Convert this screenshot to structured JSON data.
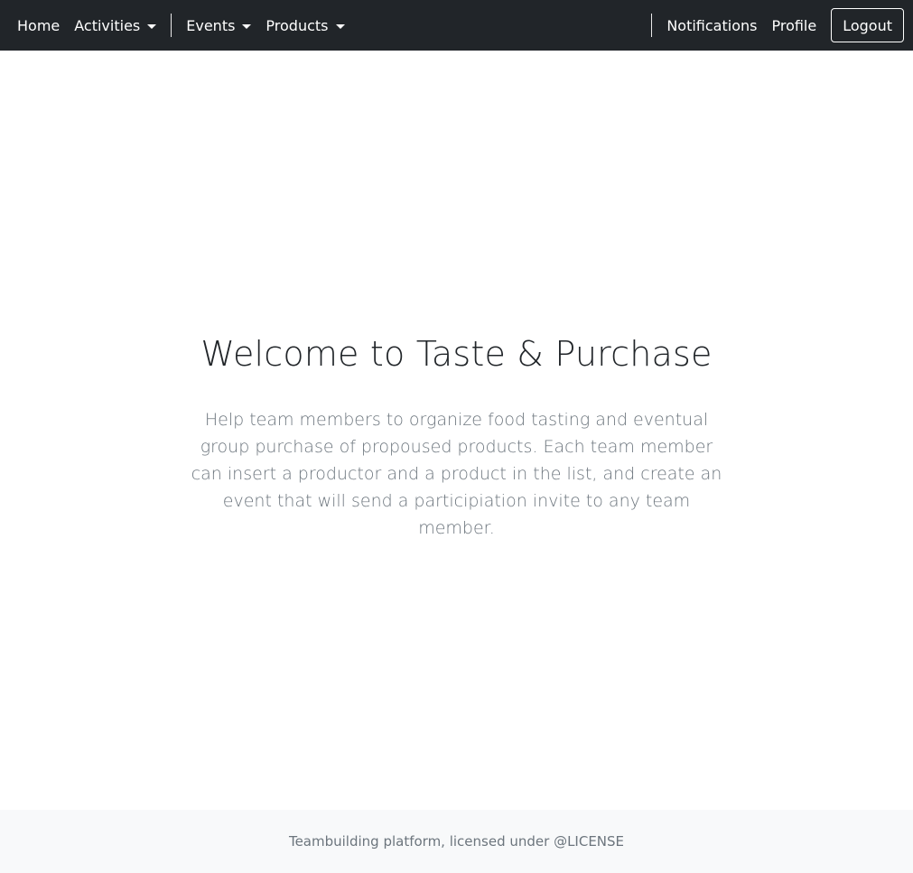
{
  "navbar": {
    "left": {
      "home_label": "Home",
      "activities_label": "Activities",
      "events_label": "Events",
      "products_label": "Products"
    },
    "right": {
      "notifications_label": "Notifications",
      "profile_label": "Profile",
      "logout_label": "Logout"
    },
    "icons": {
      "dropdown_caret": "chevron-down-icon"
    },
    "colors": {
      "background": "#212529",
      "text": "#ffffff"
    }
  },
  "hero": {
    "title": "Welcome to Taste & Purchase",
    "description": "Help team members to organize food tasting and eventual group purchase of propoused products. Each team member can insert a productor and a product in the list, and create an event that will send a participiation invite to any team member."
  },
  "footer": {
    "text": "Teambuilding platform, licensed under @LICENSE",
    "background": "#f8f9fa"
  }
}
